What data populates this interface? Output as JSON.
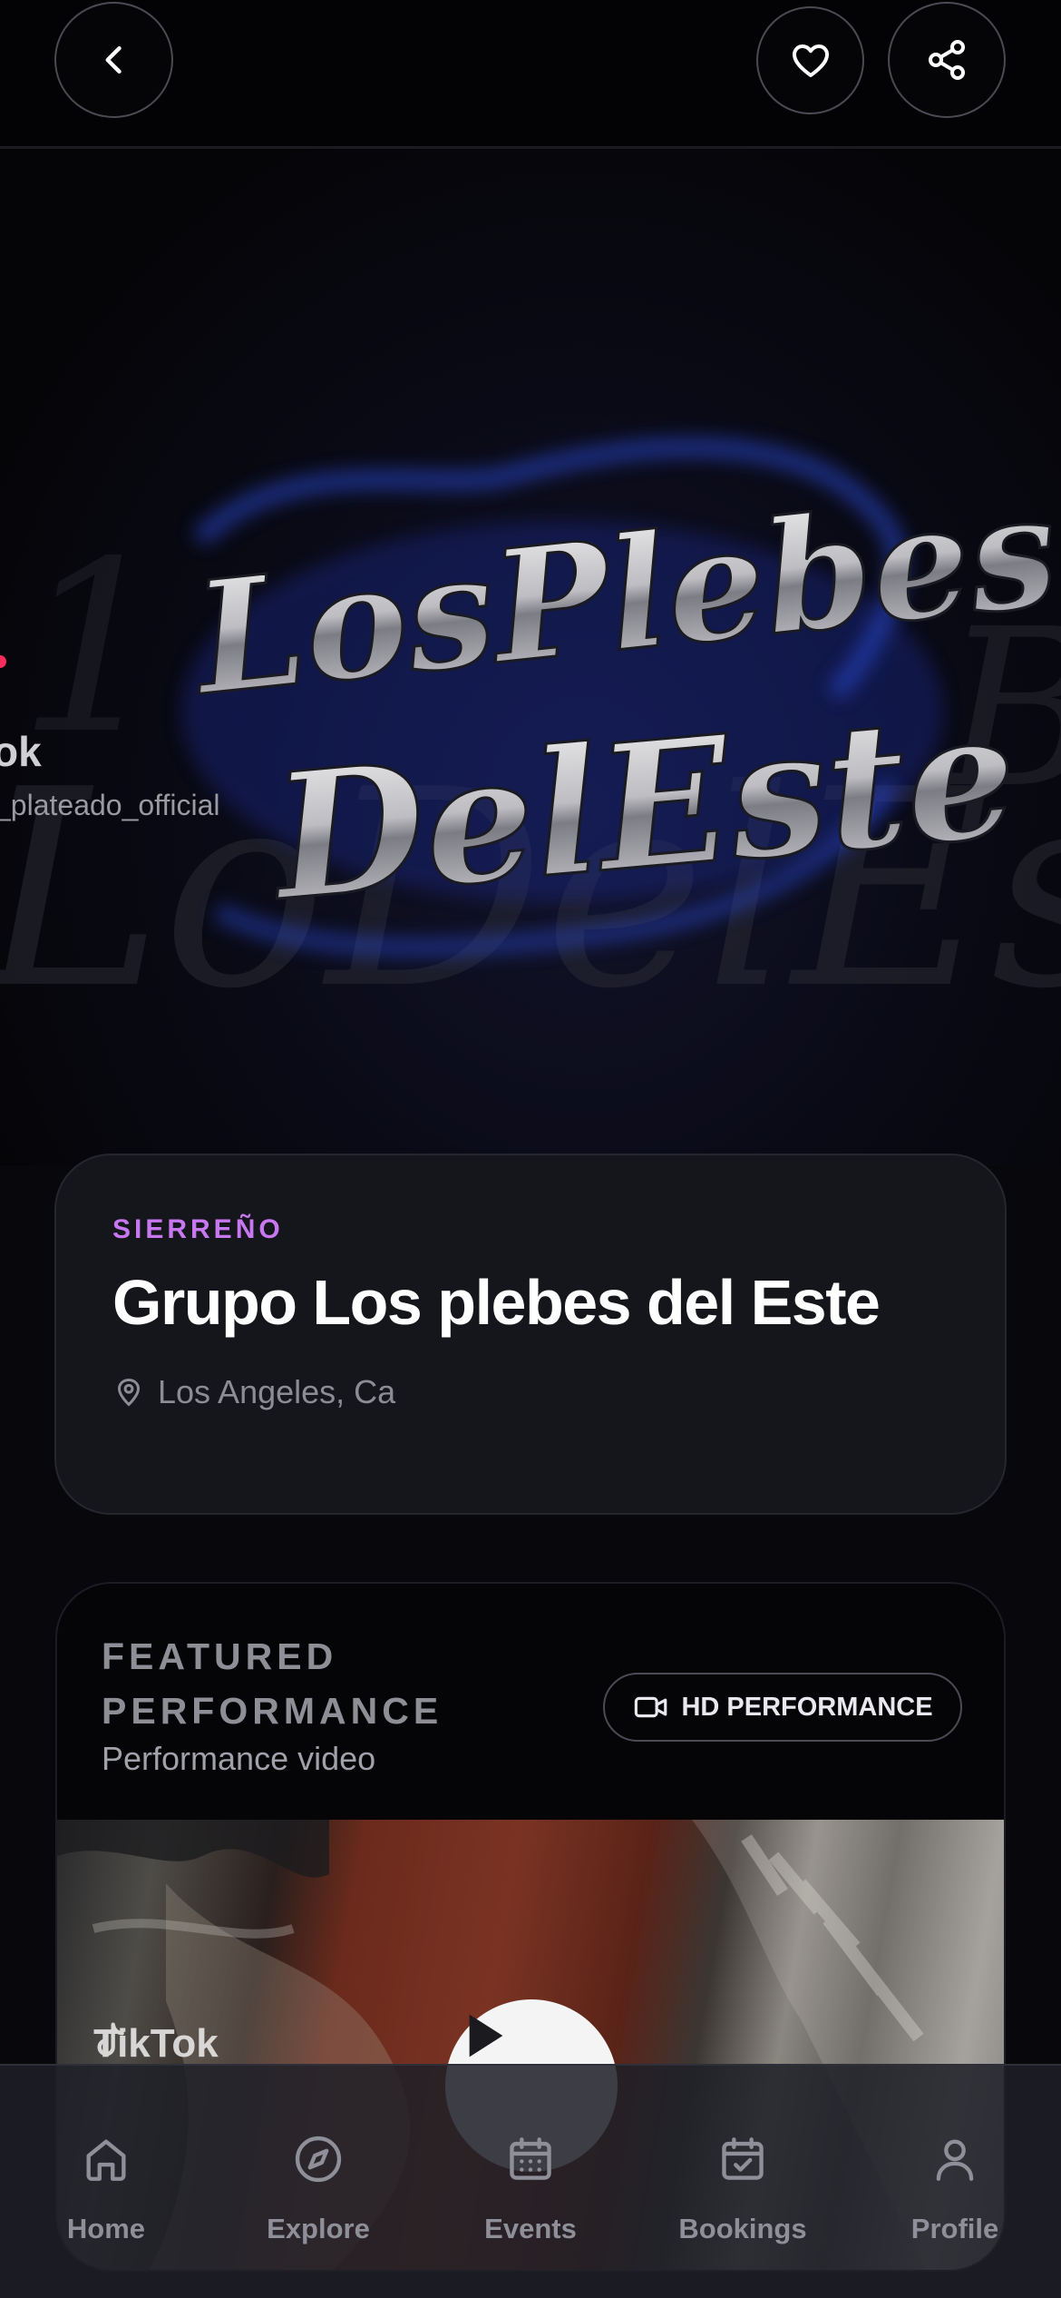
{
  "colors": {
    "background": "#07070c",
    "card": "#15161c",
    "accent": "#c778f0",
    "muted_text": "#8b8c94"
  },
  "topbar": {
    "back_icon": "chevron-left-icon",
    "favorite_icon": "heart-icon",
    "share_icon": "share-icon"
  },
  "hero": {
    "image_description_icon": "band-logo-artwork",
    "logo_line1": "LosPlebes",
    "logo_line2": "DelEste",
    "watermark_handle": "_plateado_official",
    "watermark_fragment": "ok"
  },
  "artist": {
    "genre": "SIERREÑO",
    "name": "Grupo Los plebes del Este",
    "location": "Los Angeles, Ca",
    "location_icon": "map-pin-icon"
  },
  "featured": {
    "title_line1": "FEATURED",
    "title_line2": "PERFORMANCE",
    "subtitle": "Performance video",
    "badge_label": "HD PERFORMANCE",
    "badge_icon": "video-camera-icon",
    "video": {
      "watermark": "TikTok",
      "play_icon": "play-icon"
    }
  },
  "bottom_nav": {
    "items": [
      {
        "label": "Home",
        "icon": "home-icon"
      },
      {
        "label": "Explore",
        "icon": "compass-icon"
      },
      {
        "label": "Events",
        "icon": "calendar-icon"
      },
      {
        "label": "Bookings",
        "icon": "calendar-check-icon"
      },
      {
        "label": "Profile",
        "icon": "user-icon"
      }
    ]
  }
}
